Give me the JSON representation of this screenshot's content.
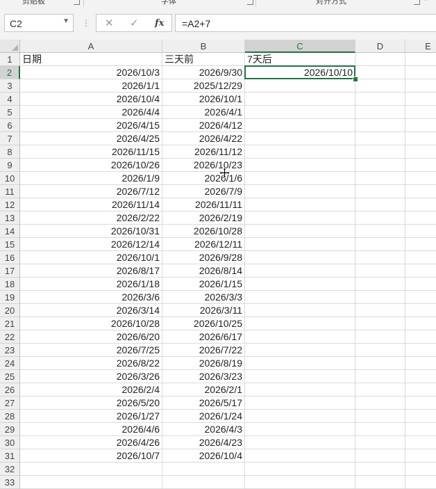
{
  "ribbon": {
    "groups": [
      "剪贴板",
      "字体",
      "对齐方式"
    ]
  },
  "formula_bar": {
    "name_box": "C2",
    "cancel_icon": "✕",
    "enter_icon": "✓",
    "fx_label": "fx",
    "formula": "=A2+7"
  },
  "sheet": {
    "columns": [
      "A",
      "B",
      "C",
      "D",
      "E"
    ],
    "rows": [
      "1",
      "2",
      "3",
      "4",
      "5",
      "6",
      "7",
      "8",
      "9",
      "10",
      "11",
      "12",
      "13",
      "14",
      "15",
      "16",
      "17",
      "18",
      "19",
      "20",
      "21",
      "22",
      "23",
      "24",
      "25",
      "26",
      "27",
      "28",
      "29",
      "30",
      "31",
      "32",
      "33"
    ],
    "header_row": {
      "a": "日期",
      "b": "三天前",
      "c": "7天后"
    },
    "data": [
      {
        "a": "2026/10/3",
        "b": "2026/9/30",
        "c": "2026/10/10"
      },
      {
        "a": "2026/1/1",
        "b": "2025/12/29",
        "c": ""
      },
      {
        "a": "2026/10/4",
        "b": "2026/10/1",
        "c": ""
      },
      {
        "a": "2026/4/4",
        "b": "2026/4/1",
        "c": ""
      },
      {
        "a": "2026/4/15",
        "b": "2026/4/12",
        "c": ""
      },
      {
        "a": "2026/4/25",
        "b": "2026/4/22",
        "c": ""
      },
      {
        "a": "2026/11/15",
        "b": "2026/11/12",
        "c": ""
      },
      {
        "a": "2026/10/26",
        "b": "2026/10/23",
        "c": ""
      },
      {
        "a": "2026/1/9",
        "b": "2026/1/6",
        "c": ""
      },
      {
        "a": "2026/7/12",
        "b": "2026/7/9",
        "c": ""
      },
      {
        "a": "2026/11/14",
        "b": "2026/11/11",
        "c": ""
      },
      {
        "a": "2026/2/22",
        "b": "2026/2/19",
        "c": ""
      },
      {
        "a": "2026/10/31",
        "b": "2026/10/28",
        "c": ""
      },
      {
        "a": "2026/12/14",
        "b": "2026/12/11",
        "c": ""
      },
      {
        "a": "2026/10/1",
        "b": "2026/9/28",
        "c": ""
      },
      {
        "a": "2026/8/17",
        "b": "2026/8/14",
        "c": ""
      },
      {
        "a": "2026/1/18",
        "b": "2026/1/15",
        "c": ""
      },
      {
        "a": "2026/3/6",
        "b": "2026/3/3",
        "c": ""
      },
      {
        "a": "2026/3/14",
        "b": "2026/3/11",
        "c": ""
      },
      {
        "a": "2026/10/28",
        "b": "2026/10/25",
        "c": ""
      },
      {
        "a": "2026/6/20",
        "b": "2026/6/17",
        "c": ""
      },
      {
        "a": "2026/7/25",
        "b": "2026/7/22",
        "c": ""
      },
      {
        "a": "2026/8/22",
        "b": "2026/8/19",
        "c": ""
      },
      {
        "a": "2026/3/26",
        "b": "2026/3/23",
        "c": ""
      },
      {
        "a": "2026/2/4",
        "b": "2026/2/1",
        "c": ""
      },
      {
        "a": "2026/5/20",
        "b": "2026/5/17",
        "c": ""
      },
      {
        "a": "2026/1/27",
        "b": "2026/1/24",
        "c": ""
      },
      {
        "a": "2026/4/6",
        "b": "2026/4/3",
        "c": ""
      },
      {
        "a": "2026/4/26",
        "b": "2026/4/23",
        "c": ""
      },
      {
        "a": "2026/10/7",
        "b": "2026/10/4",
        "c": ""
      }
    ],
    "selected_cell": "C2",
    "colors": {
      "selection": "#217346",
      "gridline": "#dadada",
      "header_bg": "#efefef"
    }
  }
}
